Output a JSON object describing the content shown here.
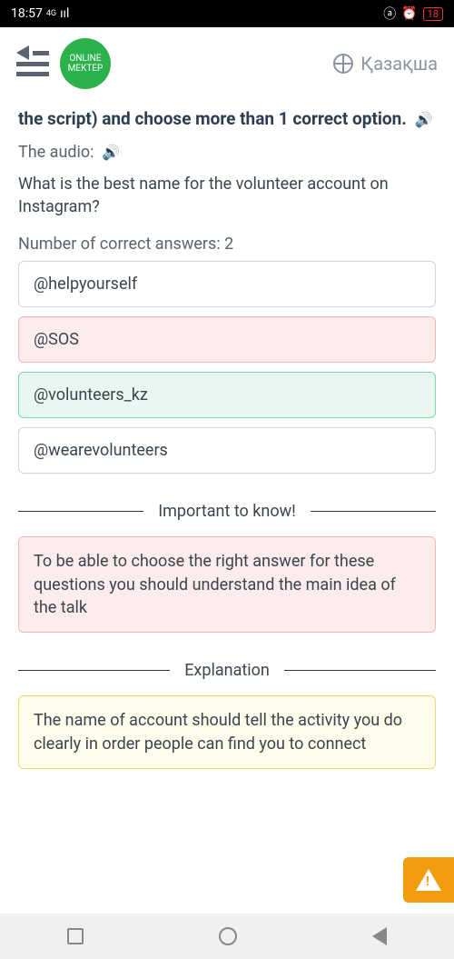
{
  "status_bar": {
    "time": "18:57",
    "network": "4G",
    "battery": "18"
  },
  "header": {
    "logo_line1": "ONLINE",
    "logo_line2": "MEKTEP",
    "language": "Қазақша"
  },
  "question": {
    "title": "the script) and choose more than 1 correct option.",
    "audio_label": "The audio:",
    "text": "What is the best name for the volunteer account on Instagram?",
    "answer_count": "Number of correct answers: 2",
    "options": [
      {
        "text": "@helpyourself",
        "state": "neutral"
      },
      {
        "text": "@SOS",
        "state": "incorrect"
      },
      {
        "text": "@volunteers_kz",
        "state": "correct"
      },
      {
        "text": "@wearevolunteers",
        "state": "neutral"
      }
    ]
  },
  "important": {
    "title": "Important to know!",
    "text": "To be able to choose the right answer for these questions you should understand the main idea of the talk"
  },
  "explanation": {
    "title": "Explanation",
    "text": "The name of account should tell the activity you do clearly in order people can find you to connect"
  }
}
